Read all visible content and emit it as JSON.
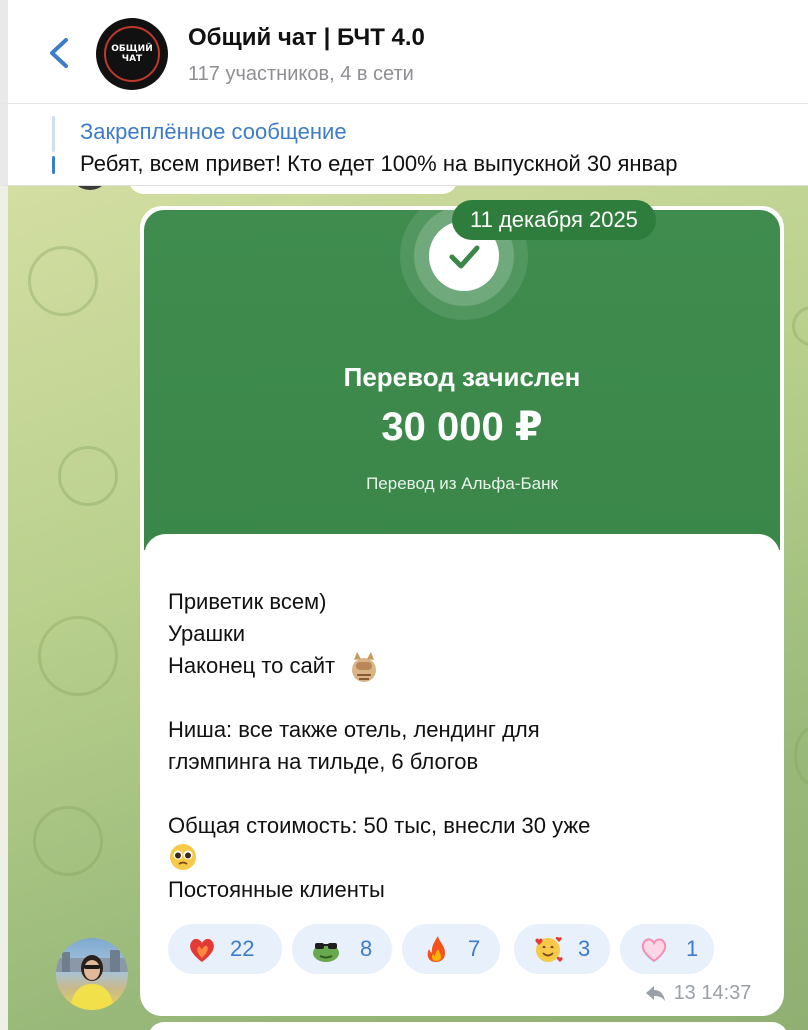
{
  "header": {
    "title": "Общий чат | БЧТ 4.0",
    "subtitle": "117 участников, 4 в сети",
    "avatar_text_1": "ОБЩИЙ",
    "avatar_text_2": "ЧАТ"
  },
  "pinned": {
    "label": "Закреплённое сообщение",
    "text": "Ребят, всем привет! Кто едет 100% на выпускной 30 январ"
  },
  "message": {
    "date": "11 декабря 2025",
    "bank": {
      "title": "Перевод зачислен",
      "amount": "30 000 ₽",
      "from": "Перевод из Альфа-Банк"
    },
    "lines": [
      "Приветик всем)",
      "Урашки",
      "Наконец то сайт",
      "Ниша: все также отель, лендинг для",
      "глэмпинга на тильде, 6 блогов",
      "Общая стоимость: 50 тыс, внесли 30 уже",
      "Постоянные клиенты"
    ],
    "reactions": [
      {
        "icon": "heart-on-fire-icon",
        "count": "22"
      },
      {
        "icon": "frog-sunglasses-icon",
        "count": "8"
      },
      {
        "icon": "fire-icon",
        "count": "7"
      },
      {
        "icon": "smiling-face-with-hearts-icon",
        "count": "3"
      },
      {
        "icon": "pink-heart-icon",
        "count": "1"
      }
    ],
    "forwards": "13",
    "time": "14:37"
  },
  "colors": {
    "accent": "#3d7cc9",
    "bank_green": "#3f8c4e",
    "date_pill": "#2f7d3c",
    "reaction_bg": "#e8f0fb"
  }
}
